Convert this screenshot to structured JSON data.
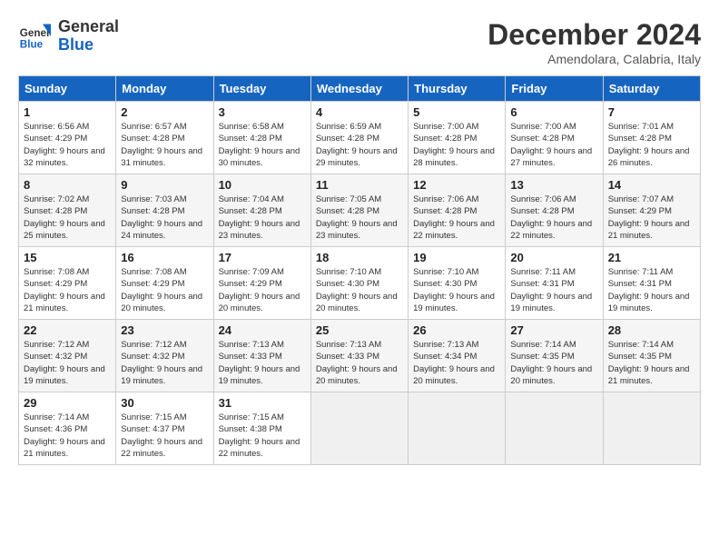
{
  "header": {
    "logo_general": "General",
    "logo_blue": "Blue",
    "month_title": "December 2024",
    "location": "Amendolara, Calabria, Italy"
  },
  "weekdays": [
    "Sunday",
    "Monday",
    "Tuesday",
    "Wednesday",
    "Thursday",
    "Friday",
    "Saturday"
  ],
  "weeks": [
    [
      {
        "day": "1",
        "sunrise": "6:56 AM",
        "sunset": "4:29 PM",
        "daylight": "9 hours and 32 minutes."
      },
      {
        "day": "2",
        "sunrise": "6:57 AM",
        "sunset": "4:28 PM",
        "daylight": "9 hours and 31 minutes."
      },
      {
        "day": "3",
        "sunrise": "6:58 AM",
        "sunset": "4:28 PM",
        "daylight": "9 hours and 30 minutes."
      },
      {
        "day": "4",
        "sunrise": "6:59 AM",
        "sunset": "4:28 PM",
        "daylight": "9 hours and 29 minutes."
      },
      {
        "day": "5",
        "sunrise": "7:00 AM",
        "sunset": "4:28 PM",
        "daylight": "9 hours and 28 minutes."
      },
      {
        "day": "6",
        "sunrise": "7:00 AM",
        "sunset": "4:28 PM",
        "daylight": "9 hours and 27 minutes."
      },
      {
        "day": "7",
        "sunrise": "7:01 AM",
        "sunset": "4:28 PM",
        "daylight": "9 hours and 26 minutes."
      }
    ],
    [
      {
        "day": "8",
        "sunrise": "7:02 AM",
        "sunset": "4:28 PM",
        "daylight": "9 hours and 25 minutes."
      },
      {
        "day": "9",
        "sunrise": "7:03 AM",
        "sunset": "4:28 PM",
        "daylight": "9 hours and 24 minutes."
      },
      {
        "day": "10",
        "sunrise": "7:04 AM",
        "sunset": "4:28 PM",
        "daylight": "9 hours and 23 minutes."
      },
      {
        "day": "11",
        "sunrise": "7:05 AM",
        "sunset": "4:28 PM",
        "daylight": "9 hours and 23 minutes."
      },
      {
        "day": "12",
        "sunrise": "7:06 AM",
        "sunset": "4:28 PM",
        "daylight": "9 hours and 22 minutes."
      },
      {
        "day": "13",
        "sunrise": "7:06 AM",
        "sunset": "4:28 PM",
        "daylight": "9 hours and 22 minutes."
      },
      {
        "day": "14",
        "sunrise": "7:07 AM",
        "sunset": "4:29 PM",
        "daylight": "9 hours and 21 minutes."
      }
    ],
    [
      {
        "day": "15",
        "sunrise": "7:08 AM",
        "sunset": "4:29 PM",
        "daylight": "9 hours and 21 minutes."
      },
      {
        "day": "16",
        "sunrise": "7:08 AM",
        "sunset": "4:29 PM",
        "daylight": "9 hours and 20 minutes."
      },
      {
        "day": "17",
        "sunrise": "7:09 AM",
        "sunset": "4:29 PM",
        "daylight": "9 hours and 20 minutes."
      },
      {
        "day": "18",
        "sunrise": "7:10 AM",
        "sunset": "4:30 PM",
        "daylight": "9 hours and 20 minutes."
      },
      {
        "day": "19",
        "sunrise": "7:10 AM",
        "sunset": "4:30 PM",
        "daylight": "9 hours and 19 minutes."
      },
      {
        "day": "20",
        "sunrise": "7:11 AM",
        "sunset": "4:31 PM",
        "daylight": "9 hours and 19 minutes."
      },
      {
        "day": "21",
        "sunrise": "7:11 AM",
        "sunset": "4:31 PM",
        "daylight": "9 hours and 19 minutes."
      }
    ],
    [
      {
        "day": "22",
        "sunrise": "7:12 AM",
        "sunset": "4:32 PM",
        "daylight": "9 hours and 19 minutes."
      },
      {
        "day": "23",
        "sunrise": "7:12 AM",
        "sunset": "4:32 PM",
        "daylight": "9 hours and 19 minutes."
      },
      {
        "day": "24",
        "sunrise": "7:13 AM",
        "sunset": "4:33 PM",
        "daylight": "9 hours and 19 minutes."
      },
      {
        "day": "25",
        "sunrise": "7:13 AM",
        "sunset": "4:33 PM",
        "daylight": "9 hours and 20 minutes."
      },
      {
        "day": "26",
        "sunrise": "7:13 AM",
        "sunset": "4:34 PM",
        "daylight": "9 hours and 20 minutes."
      },
      {
        "day": "27",
        "sunrise": "7:14 AM",
        "sunset": "4:35 PM",
        "daylight": "9 hours and 20 minutes."
      },
      {
        "day": "28",
        "sunrise": "7:14 AM",
        "sunset": "4:35 PM",
        "daylight": "9 hours and 21 minutes."
      }
    ],
    [
      {
        "day": "29",
        "sunrise": "7:14 AM",
        "sunset": "4:36 PM",
        "daylight": "9 hours and 21 minutes."
      },
      {
        "day": "30",
        "sunrise": "7:15 AM",
        "sunset": "4:37 PM",
        "daylight": "9 hours and 22 minutes."
      },
      {
        "day": "31",
        "sunrise": "7:15 AM",
        "sunset": "4:38 PM",
        "daylight": "9 hours and 22 minutes."
      },
      null,
      null,
      null,
      null
    ]
  ],
  "labels": {
    "sunrise": "Sunrise:",
    "sunset": "Sunset:",
    "daylight": "Daylight:"
  }
}
